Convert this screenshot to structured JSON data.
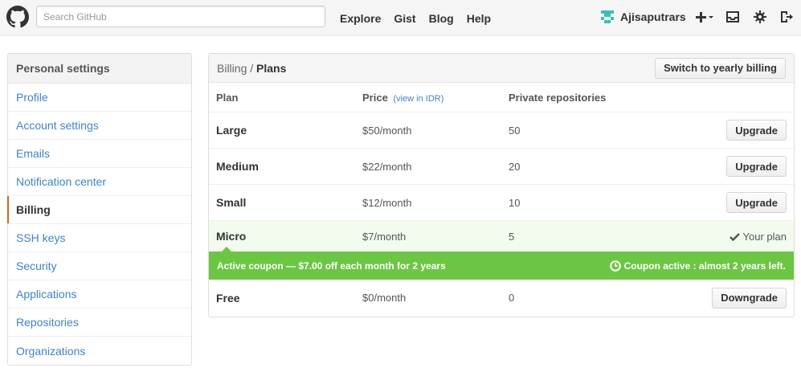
{
  "header": {
    "search_placeholder": "Search GitHub",
    "nav": [
      "Explore",
      "Gist",
      "Blog",
      "Help"
    ],
    "username": "Ajisaputrars"
  },
  "sidebar": {
    "title": "Personal settings",
    "items": [
      {
        "label": "Profile"
      },
      {
        "label": "Account settings"
      },
      {
        "label": "Emails"
      },
      {
        "label": "Notification center"
      },
      {
        "label": "Billing",
        "active": true
      },
      {
        "label": "SSH keys"
      },
      {
        "label": "Security"
      },
      {
        "label": "Applications"
      },
      {
        "label": "Repositories"
      },
      {
        "label": "Organizations"
      }
    ]
  },
  "main": {
    "breadcrumb_parent": "Billing",
    "breadcrumb_sep": "/",
    "breadcrumb_current": "Plans",
    "switch_button": "Switch to yearly billing",
    "columns": {
      "plan": "Plan",
      "price": "Price",
      "price_link": "(view in IDR)",
      "repos": "Private repositories"
    },
    "plans": [
      {
        "name": "Large",
        "price": "$50/month",
        "repos": "50",
        "action": "Upgrade"
      },
      {
        "name": "Medium",
        "price": "$22/month",
        "repos": "20",
        "action": "Upgrade"
      },
      {
        "name": "Small",
        "price": "$12/month",
        "repos": "10",
        "action": "Upgrade"
      },
      {
        "name": "Micro",
        "price": "$7/month",
        "repos": "5",
        "action": "Your plan"
      },
      {
        "name": "Free",
        "price": "$0/month",
        "repos": "0",
        "action": "Downgrade"
      }
    ],
    "coupon": {
      "text": "Active coupon — $7.00 off each month for 2 years",
      "status": "Coupon active : almost 2 years left."
    }
  },
  "colors": {
    "accent_link": "#4183c4",
    "coupon_green": "#6cc644",
    "active_bar": "#d26911"
  }
}
